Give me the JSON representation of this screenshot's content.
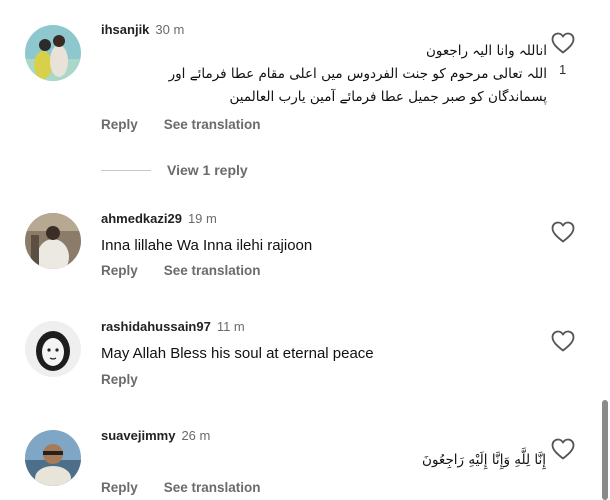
{
  "comments": [
    {
      "username": "ihsanjik",
      "time": "30 m",
      "text_lines": [
        "اناللہ وانا الیہ راجعون",
        "اللہ تعالی مرحوم کو جنت الفردوس میں اعلی مقام عطا فرمائے اور",
        "پسماندگان کو صبر جمیل عطا فرمائے آمین یارب العالمین"
      ],
      "likes": "1",
      "reply_label": "Reply",
      "translate_label": "See translation"
    },
    {
      "username": "ahmedkazi29",
      "time": "19 m",
      "text": "Inna lillahe Wa Inna ilehi rajioon",
      "reply_label": "Reply",
      "translate_label": "See translation"
    },
    {
      "username": "rashidahussain97",
      "time": "11 m",
      "text": "May Allah Bless his soul at eternal peace",
      "reply_label": "Reply"
    },
    {
      "username": "suavejimmy",
      "time": "26 m",
      "text": "إِنَّا لِلَّهِ وَإِنَّا إِلَيْهِ رَاجِعُونَ",
      "reply_label": "Reply",
      "translate_label": "See translation"
    }
  ],
  "view_replies_label": "View 1 reply",
  "icons": {
    "like": "heart-outline-icon"
  },
  "colors": {
    "meta_gray": "#6b6b6b",
    "text": "#111111"
  }
}
